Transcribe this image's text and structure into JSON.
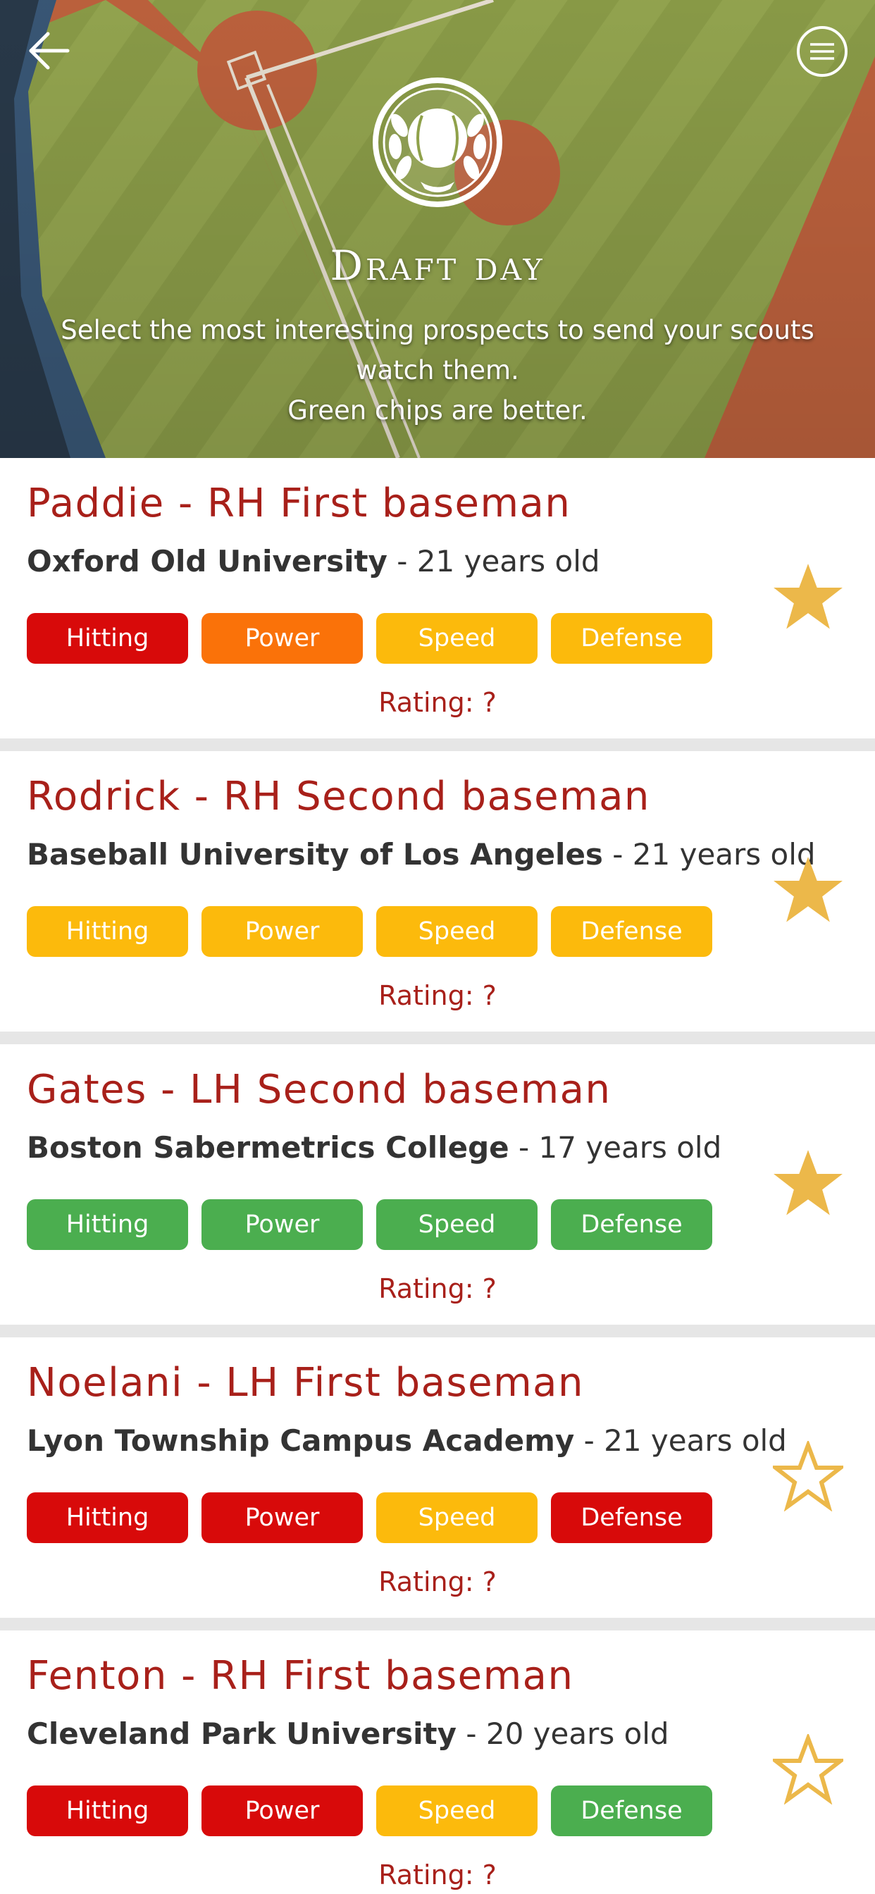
{
  "header": {
    "title": "Draft day",
    "subtitle_lines": [
      "Select the most interesting prospects to send your scouts",
      "watch them.",
      "Green chips are better."
    ],
    "back_icon": "arrow-left-icon",
    "menu_icon": "hamburger-menu-icon",
    "logo_icon": "baseball-laurel-icon"
  },
  "colors": {
    "red": "#d80a0a",
    "orange": "#fa7209",
    "yellow": "#fcba0c",
    "green": "#4bae4f",
    "title_red": "#a8201a",
    "star": "#ecb84a"
  },
  "prospects": [
    {
      "name": "Paddie - RH First baseman",
      "school": "Oxford Old University",
      "age": " - 21 years old",
      "rating": "Rating: ?",
      "starred": true,
      "chips": [
        {
          "label": "Hitting",
          "color": "red"
        },
        {
          "label": "Power",
          "color": "orange"
        },
        {
          "label": "Speed",
          "color": "yellow"
        },
        {
          "label": "Defense",
          "color": "yellow"
        }
      ]
    },
    {
      "name": "Rodrick - RH Second baseman",
      "school": "Baseball University of Los Angeles",
      "age": " - 21 years old",
      "rating": "Rating: ?",
      "starred": true,
      "chips": [
        {
          "label": "Hitting",
          "color": "yellow"
        },
        {
          "label": "Power",
          "color": "yellow"
        },
        {
          "label": "Speed",
          "color": "yellow"
        },
        {
          "label": "Defense",
          "color": "yellow"
        }
      ]
    },
    {
      "name": "Gates - LH Second baseman",
      "school": "Boston Sabermetrics College",
      "age": " - 17 years old",
      "rating": "Rating: ?",
      "starred": true,
      "chips": [
        {
          "label": "Hitting",
          "color": "green"
        },
        {
          "label": "Power",
          "color": "green"
        },
        {
          "label": "Speed",
          "color": "green"
        },
        {
          "label": "Defense",
          "color": "green"
        }
      ]
    },
    {
      "name": "Noelani - LH First baseman",
      "school": "Lyon Township Campus Academy",
      "age": " - 21 years old",
      "rating": "Rating: ?",
      "starred": false,
      "chips": [
        {
          "label": "Hitting",
          "color": "red"
        },
        {
          "label": "Power",
          "color": "red"
        },
        {
          "label": "Speed",
          "color": "yellow"
        },
        {
          "label": "Defense",
          "color": "red"
        }
      ]
    },
    {
      "name": "Fenton - RH First baseman",
      "school": "Cleveland Park University",
      "age": " - 20 years old",
      "rating": "Rating: ?",
      "starred": false,
      "chips": [
        {
          "label": "Hitting",
          "color": "red"
        },
        {
          "label": "Power",
          "color": "red"
        },
        {
          "label": "Speed",
          "color": "yellow"
        },
        {
          "label": "Defense",
          "color": "green"
        }
      ]
    }
  ]
}
